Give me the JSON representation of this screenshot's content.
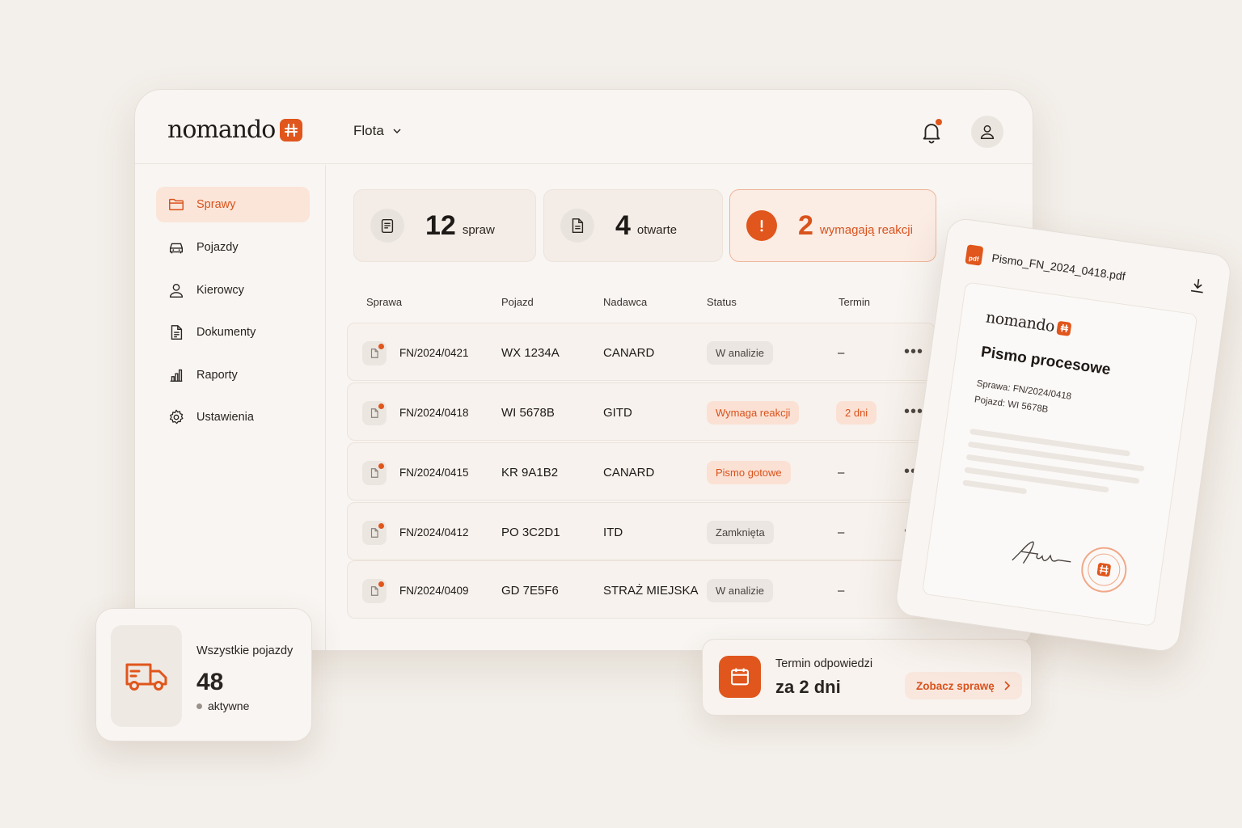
{
  "brand": {
    "name": "nomando",
    "accent": "#e0561c"
  },
  "header": {
    "org_label": "Flota"
  },
  "sidebar": {
    "items": [
      {
        "label": "Sprawy",
        "icon": "folder-icon",
        "active": true
      },
      {
        "label": "Pojazdy",
        "icon": "car-icon"
      },
      {
        "label": "Kierowcy",
        "icon": "user-icon"
      },
      {
        "label": "Dokumenty",
        "icon": "document-icon"
      },
      {
        "label": "Raporty",
        "icon": "bar-chart-icon"
      },
      {
        "label": "Ustawienia",
        "icon": "gear-icon"
      }
    ]
  },
  "stats": [
    {
      "value": "12",
      "label": "spraw",
      "icon": "clipboard-icon"
    },
    {
      "value": "4",
      "label": "otwarte",
      "icon": "document-icon"
    },
    {
      "value": "2",
      "label": "wymagają reakcji",
      "icon": "alert-icon"
    }
  ],
  "table": {
    "headers": [
      "Sprawa",
      "Pojazd",
      "Nadawca",
      "Status",
      "Termin"
    ],
    "rows": [
      {
        "case": "FN/2024/0421",
        "vehicle": "WX 1234A",
        "sender": "CANARD",
        "status": "W analizie",
        "term": "–"
      },
      {
        "case": "FN/2024/0418",
        "vehicle": "WI 5678B",
        "sender": "GITD",
        "status": "Wymaga reakcji",
        "term": "2 dni"
      },
      {
        "case": "FN/2024/0415",
        "vehicle": "KR 9A1B2",
        "sender": "CANARD",
        "status": "Pismo gotowe",
        "term": "–"
      },
      {
        "case": "FN/2024/0412",
        "vehicle": "PO 3C2D1",
        "sender": "ITD",
        "status": "Zamknięta",
        "term": "–"
      },
      {
        "case": "FN/2024/0409",
        "vehicle": "GD 7E5F6",
        "sender": "STRAŻ MIEJSKA",
        "status": "W analizie",
        "term": "–"
      }
    ]
  },
  "vehicles_card": {
    "title": "Wszystkie pojazdy",
    "count": "48",
    "status": "aktywne"
  },
  "deadline_card": {
    "title": "Termin odpowiedzi",
    "value": "za 2 dni",
    "action": "Zobacz sprawę"
  },
  "pdf_card": {
    "filename": "Pismo_FN_2024_0418.pdf",
    "badge": "pdf",
    "doc_brand": "nomando",
    "doc_title": "Pismo procesowe",
    "case_line": "Sprawa: FN/2024/0418",
    "vehicle_line": "Pojazd: WI 5678B"
  }
}
